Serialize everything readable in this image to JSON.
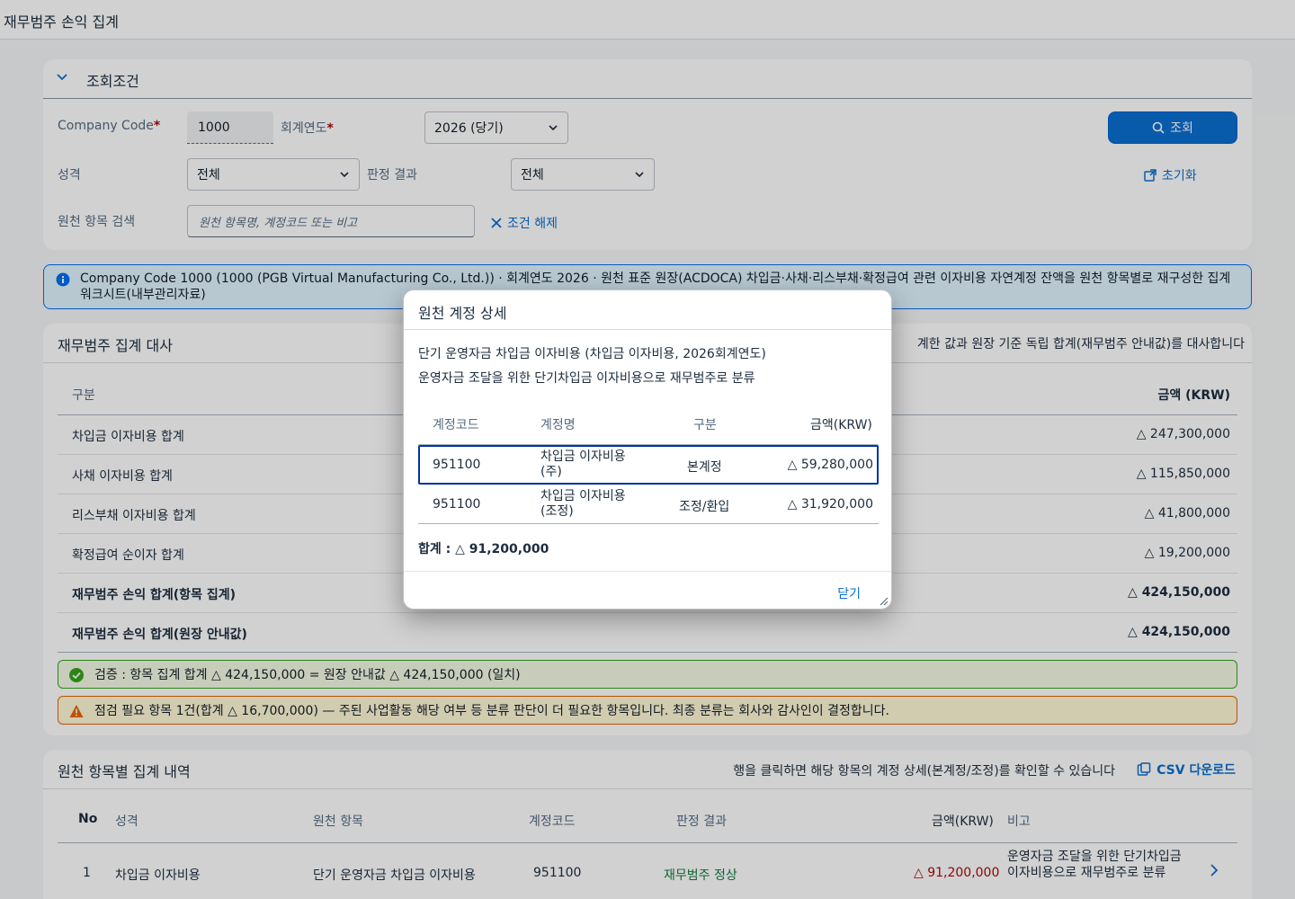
{
  "app": {
    "title": "재무범주 손익 집계"
  },
  "filter": {
    "title": "조회조건",
    "company_code_label": "Company Code",
    "company_code_value": "1000",
    "fiscal_year_label": "회계연도",
    "fiscal_year_value": "2026 (당기)",
    "nature_label": "성격",
    "nature_value": "전체",
    "judgment_label": "판정 결과",
    "judgment_value": "전체",
    "search_label": "원천 항목 검색",
    "search_placeholder": "원천 항목명, 계정코드 또는 비고",
    "clear_label": "조건 해제",
    "query_label": "조회",
    "reset_label": "초기화",
    "required_mark": "*"
  },
  "info": {
    "text": "Company Code 1000 (1000 (PGB Virtual Manufacturing Co., Ltd.)) · 회계연도 2026 · 원천 표준 원장(ACDOCA) 차입금·사채·리스부채·확정급여 관련 이자비용 자연계정 잔액을 원천 항목별로 재구성한 집계 워크시트(내부관리자료)"
  },
  "recon": {
    "title": "재무범주 집계 대사",
    "note": "계한 값과 원장 기준 독립 합계(재무범주 안내값)를 대사합니다",
    "col_label": "구분",
    "col_amount": "금액 (KRW)",
    "rows": [
      {
        "label": "차입금 이자비용 합계",
        "amount": "△ 247,300,000"
      },
      {
        "label": "사채 이자비용 합계",
        "amount": "△ 115,850,000"
      },
      {
        "label": "리스부채 이자비용 합계",
        "amount": "△ 41,800,000"
      },
      {
        "label": "확정급여 순이자 합계",
        "amount": "△ 19,200,000"
      },
      {
        "label": "재무범주 손익 합계(항목 집계)",
        "amount": "△ 424,150,000"
      },
      {
        "label": "재무범주 손익 합계(원장 안내값)",
        "amount": "△ 424,150,000"
      }
    ],
    "success_msg": "검증 : 항목 집계 합계 △ 424,150,000 = 원장 안내값 △ 424,150,000 (일치)",
    "warn_msg": "점검 필요 항목 1건(합계 △ 16,700,000) — 주된 사업활동 해당 여부 등 분류 판단이 더 필요한 항목입니다. 최종 분류는 회사와 감사인이 결정합니다."
  },
  "detail": {
    "title": "원천 항목별 집계 내역",
    "hint": "행을 클릭하면 해당 항목의 계정 상세(본계정/조정)를 확인할 수 있습니다",
    "csv_label": "CSV 다운로드",
    "columns": {
      "no": "No",
      "nature": "성격",
      "source": "원천 항목",
      "account": "계정코드",
      "judgment": "판정 결과",
      "amount": "금액(KRW)",
      "remark": "비고"
    },
    "rows": [
      {
        "no": "1",
        "nature": "차입금 이자비용",
        "source": "단기 운영자금 차입금 이자비용",
        "account": "951100",
        "judgment": "재무범주 정상",
        "amount": "△ 91,200,000",
        "remark": "운영자금 조달을 위한 단기차입금 이자비용으로 재무범주로 분류"
      }
    ]
  },
  "dialog": {
    "title": "원천 계정 상세",
    "desc1": "단기 운영자금 차입금 이자비용 (차입금 이자비용, 2026회계연도)",
    "desc2": "운영자금 조달을 위한 단기차입금 이자비용으로 재무범주로 분류",
    "columns": {
      "account": "계정코드",
      "name": "계정명",
      "type": "구분",
      "amount": "금액(KRW)"
    },
    "rows": [
      {
        "account": "951100",
        "name1": "차입금 이자비용",
        "name2": "(주)",
        "type": "본계정",
        "amount": "△ 59,280,000"
      },
      {
        "account": "951100",
        "name1": "차입금 이자비용",
        "name2": "(조정)",
        "type": "조정/환입",
        "amount": "△ 31,920,000"
      }
    ],
    "total": "합계 : △ 91,200,000",
    "close_label": "닫기"
  },
  "colors": {
    "accent": "#0a6ed1",
    "positive": "#107e3e",
    "negative": "#aa0808",
    "success_bg": "#f5fae5",
    "warn_bg": "#fff8d6",
    "info_bg": "#e1f4ff"
  }
}
